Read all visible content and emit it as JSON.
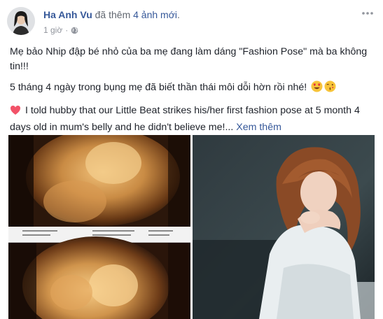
{
  "post": {
    "author": "Ha Anh Vu",
    "action_prefix": "đã thêm",
    "action_link": "4 ảnh mới",
    "action_suffix": ".",
    "time": "1 giờ",
    "separator": "·",
    "privacy_icon": "globe-icon",
    "more_icon": "ellipsis-icon"
  },
  "body": {
    "paragraph1": "Mẹ bảo Nhip đập bé nhỏ của ba mẹ đang làm dáng \"Fashion Pose\" mà ba không tin!!!",
    "paragraph2": "5 tháng 4 ngày trong bụng mẹ đã biết thần thái môi dỗi hờn rồi nhé!",
    "paragraph2_emojis": [
      "heart-eyes-emoji",
      "kissing-wink-emoji"
    ],
    "paragraph3_emoji": "heart-emoji",
    "paragraph3": " I told hubby that our Little Beat strikes his/her first fashion pose at 5 month 4 days old in mum's belly and he didn't believe me!...",
    "see_more": "Xem thêm"
  },
  "photos": [
    {
      "alt": "ultrasound-scan-photo"
    },
    {
      "alt": "woman-portrait-photo"
    }
  ],
  "colors": {
    "link": "#365899",
    "text": "#1d2129",
    "meta": "#90949c"
  }
}
